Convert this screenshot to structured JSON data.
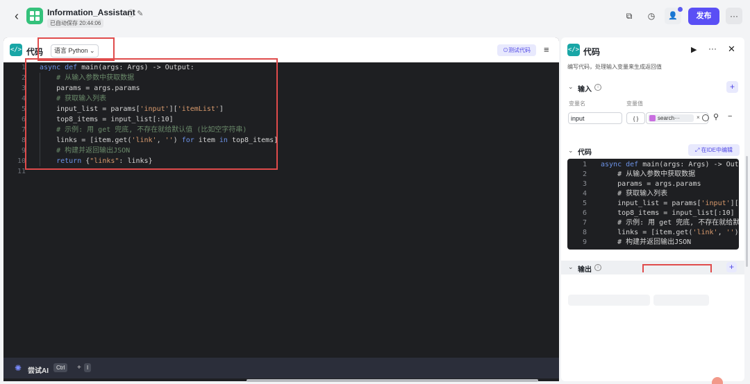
{
  "header": {
    "back_icon": "chevron-left-icon",
    "app_title": "Information_Assistant",
    "save_status": "已自动保存 20:44:06",
    "publish_label": "发布",
    "accent_color": "#5a4ff5"
  },
  "editor": {
    "title": "代码",
    "language_label": "语言 Python",
    "test_button_label": "测试代码",
    "lines": [
      "async def main(args: Args) -> Output:",
      "    # 从输入参数中获取数据",
      "    params = args.params",
      "    # 获取输入列表",
      "    input_list = params['input']['itemList']",
      "    top8_items = input_list[:10]",
      "    # 示例: 用 get 兜底, 不存在就给默认值 (比如空字符串)",
      "    links = [item.get('link', '') for item in top8_items]",
      "    # 构建并返回输出JSON",
      "    return {\"links\": links}",
      ""
    ]
  },
  "ai_bar": {
    "label": "尝试AI",
    "key1": "Ctrl",
    "plus": "+",
    "key2": "I"
  },
  "panel": {
    "title": "代码",
    "description": "编写代码，处理输入变量来生成返回值",
    "input_section": {
      "title": "输入",
      "col_name": "变量名",
      "col_value": "变量值",
      "var_name": "input",
      "var_type": "{ }",
      "var_value": "search···"
    },
    "code_section": {
      "title": "代码",
      "ide_button": "在IDE中编辑",
      "lines": [
        "async def main(args: Args) -> Outpu",
        "    # 从输入参数中获取数据",
        "    params = args.params",
        "    # 获取输入列表",
        "    input_list = params['input']['i",
        "    top8_items = input_list[:10]",
        "    # 示例: 用 get 兜底, 不存在就给默认",
        "    links = [item.get('link', '') f",
        "    # 构建并返回输出JSON"
      ]
    },
    "output_section": {
      "title": "输出"
    }
  }
}
